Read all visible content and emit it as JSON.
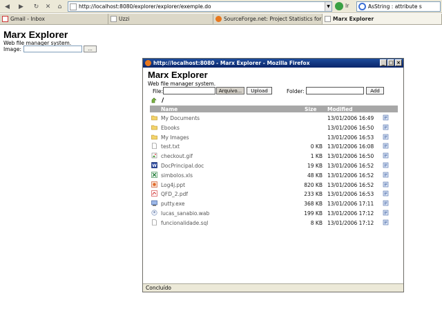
{
  "browser": {
    "url": "http://localhost:8080/explorer/explorer/exemple.do",
    "go_label": "Ir",
    "search_text": "AsString : attribute s",
    "tabs": [
      {
        "label": "Gmail - Inbox",
        "active": false
      },
      {
        "label": "Uzzi",
        "active": false
      },
      {
        "label": "SourceForge.net: Project Statistics for Marx ...",
        "active": false
      },
      {
        "label": "Marx Explorer",
        "active": true
      }
    ]
  },
  "page": {
    "title": "Marx Explorer",
    "subtitle": "Web file manager system.",
    "image_label": "Image:",
    "browse_label": "..."
  },
  "popup": {
    "window_title": "http://localhost:8080 - Marx Explorer - Mozilla Firefox",
    "title": "Marx Explorer",
    "subtitle": "Web file manager system.",
    "file_label": "File:",
    "browse_label": "Arquivo...",
    "upload_label": "Upload",
    "folder_label": "Folder:",
    "add_label": "Add",
    "current_path": "/",
    "columns": {
      "name": "Name",
      "size": "Size",
      "modified": "Modified"
    },
    "files": [
      {
        "name": "My Documents",
        "size": "",
        "modified": "13/01/2006 16:49",
        "icon": "folder-icon"
      },
      {
        "name": "Ebooks",
        "size": "",
        "modified": "13/01/2006 16:50",
        "icon": "folder-icon"
      },
      {
        "name": "My Images",
        "size": "",
        "modified": "13/01/2006 16:53",
        "icon": "folder-icon"
      },
      {
        "name": "test.txt",
        "size": "0 KB",
        "modified": "13/01/2006 16:08",
        "icon": "text-file-icon"
      },
      {
        "name": "checkout.gif",
        "size": "1 KB",
        "modified": "13/01/2006 16:50",
        "icon": "image-file-icon"
      },
      {
        "name": "DocPrincipal.doc",
        "size": "19 KB",
        "modified": "13/01/2006 16:52",
        "icon": "word-file-icon"
      },
      {
        "name": "simbolos.xls",
        "size": "48 KB",
        "modified": "13/01/2006 16:52",
        "icon": "excel-file-icon"
      },
      {
        "name": "Log4j.ppt",
        "size": "820 KB",
        "modified": "13/01/2006 16:52",
        "icon": "powerpoint-file-icon"
      },
      {
        "name": "QFD_2.pdf",
        "size": "233 KB",
        "modified": "13/01/2006 16:53",
        "icon": "pdf-file-icon"
      },
      {
        "name": "putty.exe",
        "size": "368 KB",
        "modified": "13/01/2006 17:11",
        "icon": "exe-file-icon"
      },
      {
        "name": "lucas_sanabio.wab",
        "size": "199 KB",
        "modified": "13/01/2006 17:12",
        "icon": "wab-file-icon"
      },
      {
        "name": "funcionalidade.sql",
        "size": "8 KB",
        "modified": "13/01/2006 17:12",
        "icon": "text-file-icon"
      }
    ],
    "status": "Concluído"
  },
  "colors": {
    "header_bg": "#a7a7a7",
    "title_bar": "#0a246a",
    "folder": "#f3d36b"
  }
}
